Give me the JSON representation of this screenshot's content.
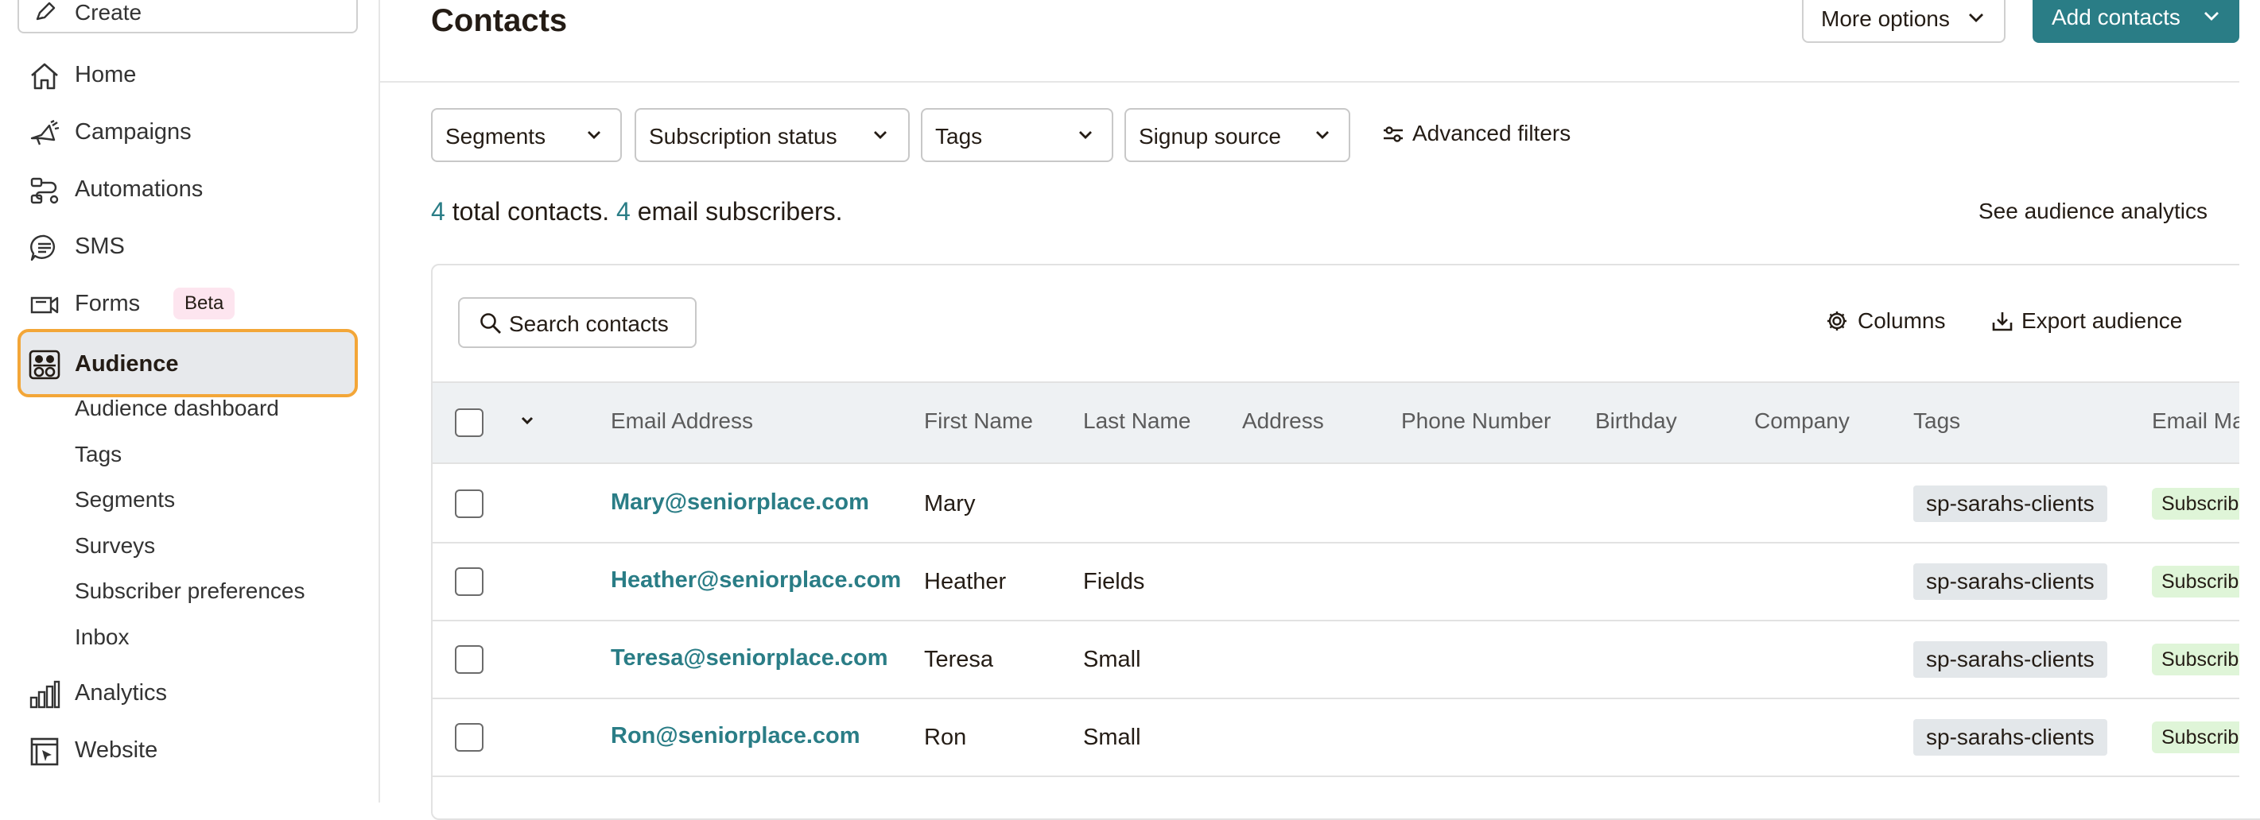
{
  "sidebar": {
    "create_label": "Create",
    "nav": [
      {
        "label": "Home"
      },
      {
        "label": "Campaigns"
      },
      {
        "label": "Automations"
      },
      {
        "label": "SMS"
      },
      {
        "label": "Forms",
        "badge": "Beta"
      },
      {
        "label": "Audience",
        "active": true
      },
      {
        "label": "Analytics"
      },
      {
        "label": "Website"
      }
    ],
    "audience_sub": [
      "Audience dashboard",
      "Tags",
      "Segments",
      "Surveys",
      "Subscriber preferences",
      "Inbox"
    ]
  },
  "header": {
    "title": "Contacts",
    "more_options": "More options",
    "add_contacts": "Add contacts"
  },
  "filters": {
    "items": [
      "Segments",
      "Subscription status",
      "Tags",
      "Signup source"
    ],
    "advanced": "Advanced filters"
  },
  "summary": {
    "total": "4",
    "total_text": " total contacts. ",
    "email": "4",
    "email_text": " email subscribers."
  },
  "analytics_link": "See audience analytics",
  "toolbar": {
    "search": "Search contacts",
    "columns": "Columns",
    "export": "Export audience"
  },
  "table": {
    "columns": [
      "Email Address",
      "First Name",
      "Last Name",
      "Address",
      "Phone Number",
      "Birthday",
      "Company",
      "Tags",
      "Email Ma"
    ],
    "rows": [
      {
        "email": "Mary@seniorplace.com",
        "first": "Mary",
        "last": "",
        "tag": "sp-sarahs-clients",
        "status": "Subscrib"
      },
      {
        "email": "Heather@seniorplace.com",
        "first": "Heather",
        "last": "Fields",
        "tag": "sp-sarahs-clients",
        "status": "Subscrib"
      },
      {
        "email": "Teresa@seniorplace.com",
        "first": "Teresa",
        "last": "Small",
        "tag": "sp-sarahs-clients",
        "status": "Subscrib"
      },
      {
        "email": "Ron@seniorplace.com",
        "first": "Ron",
        "last": "Small",
        "tag": "sp-sarahs-clients",
        "status": "Subscrib"
      }
    ]
  },
  "colors": {
    "accent": "#2a7d86",
    "active_outline": "#f3a638",
    "active_bg": "#e7e9ec",
    "tag_bg": "#e3e7ea",
    "status_bg": "#dff5d8",
    "beta_bg": "#fde5ef"
  },
  "icons": [
    "pencil-icon",
    "home-icon",
    "megaphone-icon",
    "automation-icon",
    "sms-icon",
    "forms-icon",
    "audience-icon",
    "analytics-icon",
    "website-icon",
    "chevron-down-icon",
    "sliders-icon",
    "search-icon",
    "gear-icon",
    "download-icon"
  ]
}
